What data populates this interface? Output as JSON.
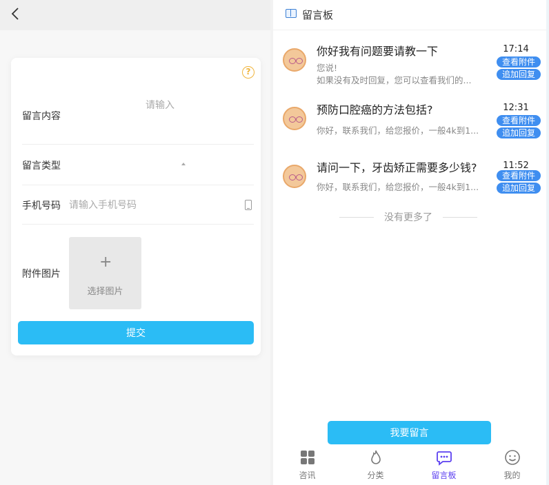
{
  "left": {
    "form": {
      "content_label": "留言内容",
      "content_placeholder": "请输入",
      "type_label": "留言类型",
      "phone_label": "手机号码",
      "phone_placeholder": "请输入手机号码",
      "attachment_label": "附件图片",
      "upload_plus": "+",
      "upload_label": "选择图片",
      "submit_label": "提交"
    }
  },
  "right": {
    "header": {
      "title": "留言板"
    },
    "messages": [
      {
        "title": "你好我有问题要请教一下",
        "line1": "您说!",
        "line2": "如果没有及时回复，您可以查看我们的...",
        "time": "17:14",
        "view_attachment": "查看附件",
        "add_reply": "追加回复"
      },
      {
        "title": "预防口腔癌的方法包括?",
        "line1": "",
        "line2": "你好，联系我们，给您报价，一般4k到1...",
        "time": "12:31",
        "view_attachment": "查看附件",
        "add_reply": "追加回复"
      },
      {
        "title": "请问一下，牙齿矫正需要多少钱?",
        "line1": "",
        "line2": "你好，联系我们，给您报价，一般4k到1...",
        "time": "11:52",
        "view_attachment": "查看附件",
        "add_reply": "追加回复"
      }
    ],
    "no_more": "没有更多了",
    "leave_message_button": "我要留言",
    "tabs": [
      {
        "label": "咨讯",
        "icon": "grid-icon"
      },
      {
        "label": "分类",
        "icon": "fire-icon"
      },
      {
        "label": "留言板",
        "icon": "chat-bubble-icon",
        "active": true
      },
      {
        "label": "我的",
        "icon": "smiley-icon"
      }
    ],
    "colors": {
      "accent": "#2bbcf5",
      "pill": "#3f8ef0",
      "active_tab": "#5b3ff0"
    }
  }
}
